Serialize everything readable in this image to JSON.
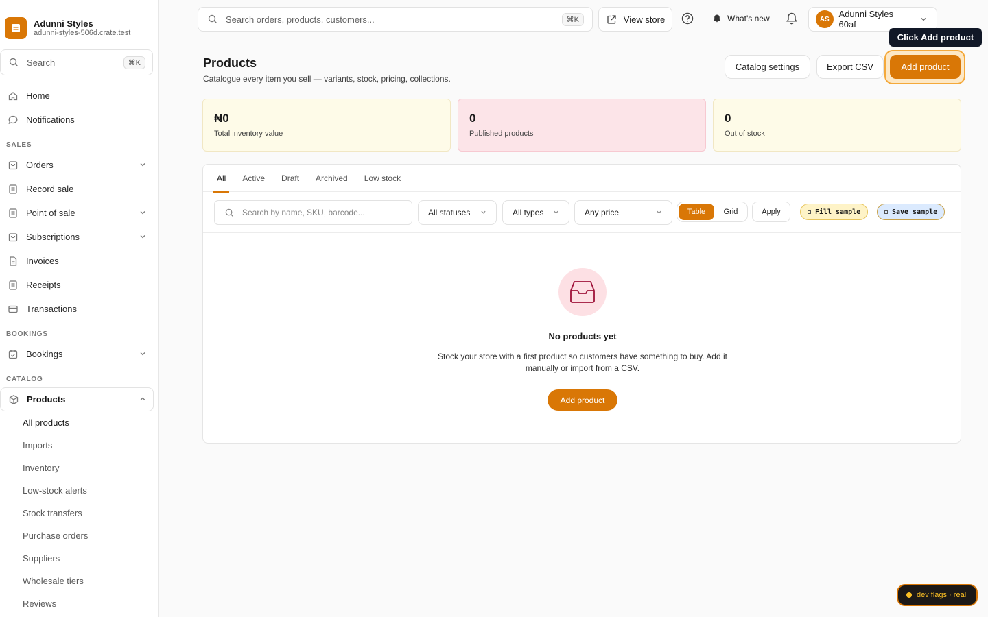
{
  "brand": {
    "name": "Adunni Styles",
    "url": "adunni-styles-506d.crate.test"
  },
  "sidebar": {
    "search_placeholder": "Search",
    "search_shortcut": "⌘K",
    "top_items": [
      {
        "label": "Home",
        "icon": "home-icon"
      },
      {
        "label": "Notifications",
        "icon": "chat-bubble-icon"
      }
    ],
    "sections": [
      {
        "title": "SALES",
        "items": [
          {
            "label": "Orders",
            "icon": "bag-icon",
            "expandable": true
          },
          {
            "label": "Record sale",
            "icon": "receipt-icon",
            "expandable": false
          },
          {
            "label": "Point of sale",
            "icon": "receipt-icon",
            "expandable": true
          },
          {
            "label": "Subscriptions",
            "icon": "bag-icon",
            "expandable": true
          },
          {
            "label": "Invoices",
            "icon": "document-icon",
            "expandable": false
          },
          {
            "label": "Receipts",
            "icon": "receipt-icon",
            "expandable": false
          },
          {
            "label": "Transactions",
            "icon": "card-icon",
            "expandable": false
          }
        ]
      },
      {
        "title": "BOOKINGS",
        "items": [
          {
            "label": "Bookings",
            "icon": "calendar-icon",
            "expandable": true
          }
        ]
      },
      {
        "title": "CATALOG",
        "items": [
          {
            "label": "Products",
            "icon": "cube-icon",
            "expandable": true,
            "expanded": true
          }
        ]
      }
    ],
    "products_sub": [
      "All products",
      "Imports",
      "Inventory",
      "Low-stock alerts",
      "Stock transfers",
      "Purchase orders",
      "Suppliers",
      "Wholesale tiers",
      "Reviews"
    ]
  },
  "topbar": {
    "search_placeholder": "Search orders, products, customers...",
    "search_shortcut": "⌘K",
    "view_store": "View store",
    "whats_new": "What's new",
    "account_initials": "AS",
    "account_name": "Adunni Styles 60af"
  },
  "tooltip": "Click Add product",
  "header": {
    "title": "Products",
    "subtitle": "Catalogue every item you sell — variants, stock, pricing, collections.",
    "catalog_settings": "Catalog settings",
    "export_csv": "Export CSV",
    "add_product": "Add product"
  },
  "stats": [
    {
      "value": "₦0",
      "label": "Total inventory value"
    },
    {
      "value": "0",
      "label": "Published products"
    },
    {
      "value": "0",
      "label": "Out of stock"
    }
  ],
  "tabs": [
    "All",
    "Active",
    "Draft",
    "Archived",
    "Low stock"
  ],
  "filters": {
    "search_placeholder": "Search by name, SKU, barcode...",
    "status": "All statuses",
    "type": "All types",
    "price": "Any price",
    "view_table": "Table",
    "view_grid": "Grid",
    "apply": "Apply",
    "fill_sample": "Fill sample",
    "save_sample": "Save sample"
  },
  "empty": {
    "title": "No products yet",
    "body": "Stock your store with a first product so customers have something to buy. Add it manually or import from a CSV.",
    "button": "Add product"
  },
  "dev_flags": "dev flags · real",
  "colors": {
    "accent": "#d97706",
    "tooltip_bg": "#111827"
  }
}
